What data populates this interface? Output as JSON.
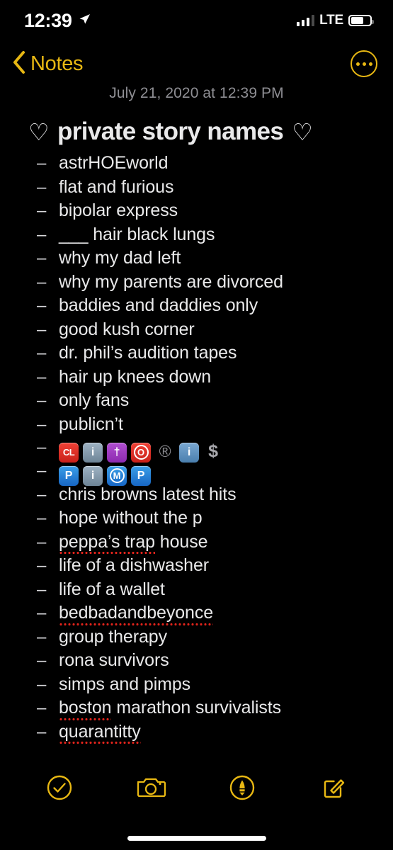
{
  "status_bar": {
    "time": "12:39",
    "location_icon": "location-arrow-icon",
    "signal_icon": "cellular-bars-icon",
    "signal_bars_filled": 3,
    "signal_bars_total": 4,
    "carrier_type": "LTE",
    "battery_icon": "battery-icon",
    "battery_level_percent": 62
  },
  "nav_bar": {
    "back_label": "Notes",
    "back_icon": "chevron-left-icon",
    "more_icon": "more-options-icon"
  },
  "note": {
    "date": "July 21, 2020 at 12:39 PM",
    "heart_left": "♡",
    "heart_right": "♡",
    "title": "private story names",
    "bullet": "–",
    "items": [
      {
        "text": "astrHOEworld",
        "type": "text",
        "misspelled": ""
      },
      {
        "text": "flat and furious",
        "type": "text",
        "misspelled": ""
      },
      {
        "text": "bipolar express",
        "type": "text",
        "misspelled": ""
      },
      {
        "text": "___ hair black lungs",
        "type": "text",
        "misspelled": ""
      },
      {
        "text": "why my dad left",
        "type": "text",
        "misspelled": ""
      },
      {
        "text": "why my parents are divorced",
        "type": "text",
        "misspelled": ""
      },
      {
        "text": "baddies and daddies only",
        "type": "text",
        "misspelled": ""
      },
      {
        "text": "good kush corner",
        "type": "text",
        "misspelled": ""
      },
      {
        "text": "dr. phil’s audition tapes",
        "type": "text",
        "misspelled": ""
      },
      {
        "text": "hair up knees down",
        "type": "text",
        "misspelled": ""
      },
      {
        "text": "only fans",
        "type": "text",
        "misspelled": ""
      },
      {
        "text": "publicn’t",
        "type": "text",
        "misspelled": ""
      },
      {
        "type": "emoji",
        "text": "🆑 ℹ️ ✝️ 🅾️ ® ℹ️ 💲",
        "tiles": [
          {
            "name": "cl-button-emoji",
            "label": "CL",
            "color": "#ef4136",
            "style": "red"
          },
          {
            "name": "information-emoji",
            "label": "i",
            "color": "#6d8496",
            "style": "grey"
          },
          {
            "name": "latin-cross-emoji",
            "label": "†",
            "color": "#8d2bb0",
            "style": "purple"
          },
          {
            "name": "o-button-emoji",
            "label": "O",
            "color": "#ef4136",
            "style": "red-circ"
          },
          {
            "name": "registered-sign-emoji",
            "label": "®",
            "color": "#8e8e93",
            "style": "glyph"
          },
          {
            "name": "information-emoji",
            "label": "i",
            "color": "#4a7fae",
            "style": "bluei"
          },
          {
            "name": "heavy-dollar-sign-emoji",
            "label": "$",
            "color": "#a8a8ad",
            "style": "glyph-dollar"
          }
        ]
      },
      {
        "type": "emoji",
        "text": "🅿️ ℹ️ Ⓜ️ 🅿️",
        "tiles": [
          {
            "name": "parking-emoji",
            "label": "P",
            "color": "#1766c4",
            "style": "blue"
          },
          {
            "name": "information-emoji",
            "label": "i",
            "color": "#6d8496",
            "style": "grey"
          },
          {
            "name": "circled-m-emoji",
            "label": "M",
            "color": "#1766c4",
            "style": "blue-circ"
          },
          {
            "name": "parking-emoji",
            "label": "P",
            "color": "#1766c4",
            "style": "blue"
          }
        ]
      },
      {
        "text": "chris browns latest hits",
        "type": "text",
        "misspelled": ""
      },
      {
        "text": "hope without the p",
        "type": "text",
        "misspelled": ""
      },
      {
        "text": "peppa’s trap house",
        "type": "text",
        "misspelled": "peppa’s trap"
      },
      {
        "text": "life of a dishwasher",
        "type": "text",
        "misspelled": ""
      },
      {
        "text": "life of a wallet",
        "type": "text",
        "misspelled": ""
      },
      {
        "text": "bedbadandbeyonce",
        "type": "text",
        "misspelled": "bedbadandbeyonce"
      },
      {
        "text": "group therapy",
        "type": "text",
        "misspelled": ""
      },
      {
        "text": "rona survivors",
        "type": "text",
        "misspelled": ""
      },
      {
        "text": "simps and pimps",
        "type": "text",
        "misspelled": ""
      },
      {
        "text": "boston marathon survivalists",
        "type": "text",
        "misspelled": "boston"
      },
      {
        "text": "quarantitty",
        "type": "text",
        "misspelled": "quarantitty"
      }
    ]
  },
  "toolbar": {
    "items": [
      {
        "name": "checklist-button",
        "icon": "circled-check-icon"
      },
      {
        "name": "camera-button",
        "icon": "camera-icon"
      },
      {
        "name": "markup-button",
        "icon": "markup-pen-icon"
      },
      {
        "name": "compose-button",
        "icon": "compose-pencil-icon"
      }
    ]
  },
  "colors": {
    "accent": "#e8b813",
    "background": "#000000",
    "body_text": "#e9e9ea",
    "secondary_text": "#8e8e93",
    "spellcheck_underline": "#e2241b"
  }
}
